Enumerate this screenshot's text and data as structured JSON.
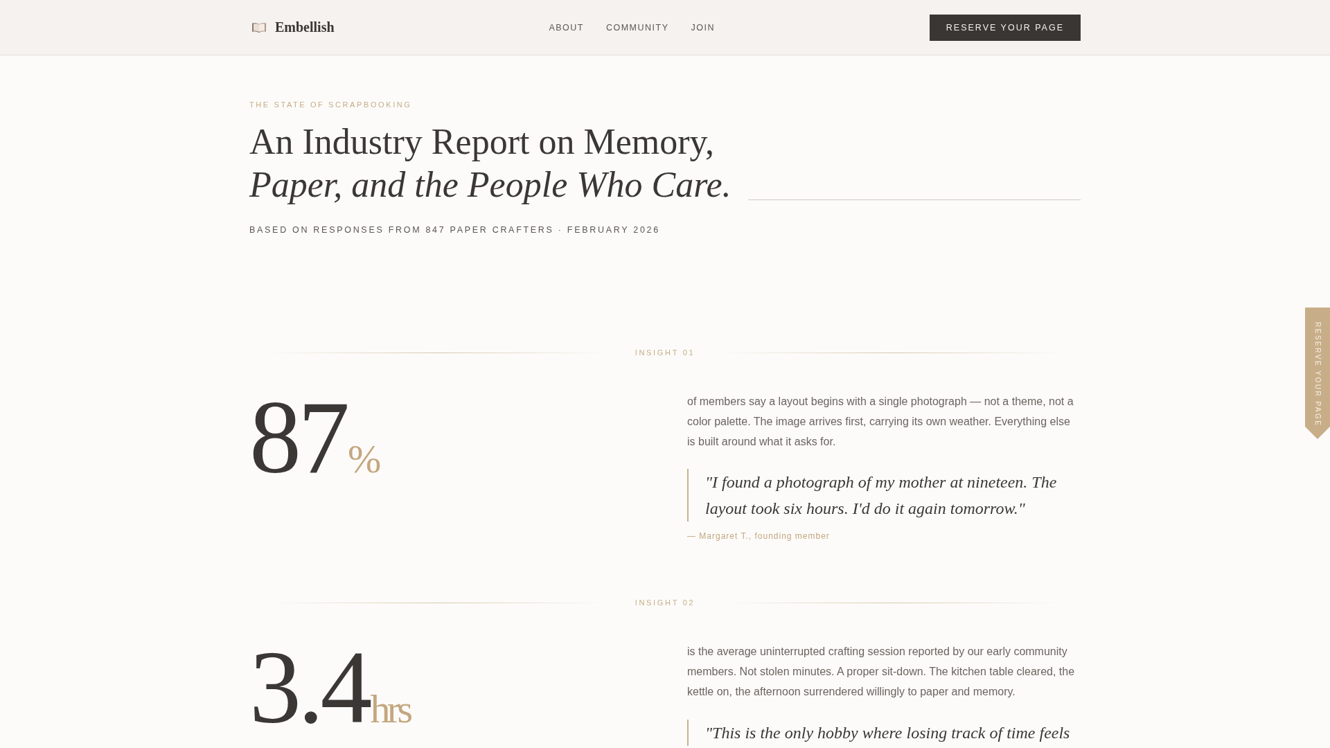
{
  "header": {
    "brand": "Embellish",
    "nav": [
      {
        "label": "ABOUT"
      },
      {
        "label": "COMMUNITY"
      },
      {
        "label": "JOIN"
      }
    ],
    "cta": "RESERVE YOUR PAGE"
  },
  "hero": {
    "eyebrow": "THE STATE OF SCRAPBOOKING",
    "title_lines": [
      "An Industry Report on Memory,",
      "*Paper, and the People Who Care.*"
    ],
    "byline": "BASED ON RESPONSES FROM 847 PAPER CRAFTERS · FEBRUARY 2026"
  },
  "insights": [
    {
      "label": "INSIGHT 01",
      "figure": "87",
      "unit": "%",
      "text": "of members say a layout begins with a single photograph — not a theme, not a color palette. The image arrives first, carrying its own weather. Everything else is built around what it asks for.",
      "quote": "\"I found a photograph of my mother at nineteen. The layout took six hours. I'd do it again tomorrow.\"",
      "attribution": "— Margaret T., founding member"
    },
    {
      "label": "INSIGHT 02",
      "figure": "3.4",
      "unit": "hrs",
      "text": "is the average uninterrupted crafting session reported by our early community members. Not stolen minutes. A proper sit-down. The kitchen table cleared, the kettle on, the afternoon surrendered willingly to paper and memory.",
      "quote": "\"This is the only hobby where losing track of time feels"
    }
  ],
  "side_tab": {
    "label": "RESERVE YOUR PAGE"
  }
}
